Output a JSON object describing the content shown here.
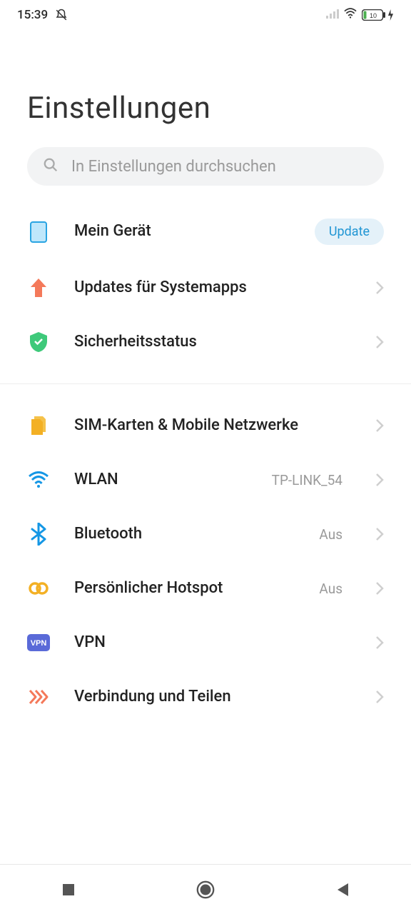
{
  "status_bar": {
    "time": "15:39",
    "battery_pct": "10"
  },
  "page_title": "Einstellungen",
  "search": {
    "placeholder": "In Einstellungen durchsuchen"
  },
  "group1": [
    {
      "icon": "device",
      "label": "Mein Gerät",
      "badge": "Update",
      "chevron": false
    },
    {
      "icon": "arrow-up",
      "label": "Updates für Systemapps",
      "chevron": true
    },
    {
      "icon": "shield",
      "label": "Sicherheitsstatus",
      "chevron": true
    }
  ],
  "group2": [
    {
      "icon": "sim",
      "label": "SIM-Karten & Mobile Netzwerke",
      "chevron": true
    },
    {
      "icon": "wifi",
      "label": "WLAN",
      "value": "TP-LINK_54",
      "chevron": true
    },
    {
      "icon": "bluetooth",
      "label": "Bluetooth",
      "value": "Aus",
      "chevron": true
    },
    {
      "icon": "hotspot",
      "label": "Persönlicher Hotspot",
      "value": "Aus",
      "chevron": true
    },
    {
      "icon": "vpn",
      "label": "VPN",
      "chevron": true
    },
    {
      "icon": "share",
      "label": "Verbindung und Teilen",
      "chevron": true
    }
  ]
}
